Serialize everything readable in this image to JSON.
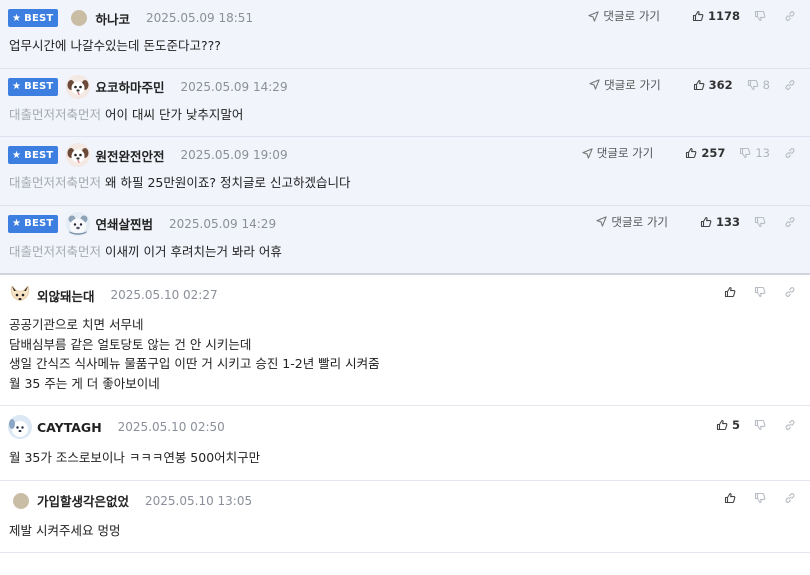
{
  "labels": {
    "best": "BEST",
    "reply": "댓글로 가기"
  },
  "comments": [
    {
      "best": true,
      "nick": "하나코",
      "date": "2025.05.09 18:51",
      "up": "1178",
      "down": "",
      "show_reply": true,
      "quote": "",
      "lines": [
        "업무시간에 나갈수있는데 돈도준다고???"
      ]
    },
    {
      "best": true,
      "nick": "요코하마주민",
      "date": "2025.05.09 14:29",
      "up": "362",
      "down": "8",
      "show_reply": true,
      "quote": "대출먼저저축먼저",
      "lines": [
        "어이 대씨 단가 낮추지말어"
      ]
    },
    {
      "best": true,
      "nick": "원전완전안전",
      "date": "2025.05.09 19:09",
      "up": "257",
      "down": "13",
      "show_reply": true,
      "quote": "대출먼저저축먼저",
      "lines": [
        "왜 하필 25만원이죠? 정치글로 신고하겠습니다"
      ]
    },
    {
      "best": true,
      "nick": "연쇄살찐범",
      "date": "2025.05.09 14:29",
      "up": "133",
      "down": "",
      "show_reply": true,
      "quote": "대출먼저저축먼저",
      "lines": [
        "이새끼 이거 후려치는거 봐라 어휴"
      ]
    },
    {
      "best": false,
      "nick": "외않돼는대",
      "date": "2025.05.10 02:27",
      "up": "",
      "down": "",
      "show_reply": false,
      "quote": "",
      "lines": [
        "공공기관으로 치면 서무네",
        "담배심부름 같은 얼토당토 않는 건 안 시키는데",
        "생일 간식즈 식사메뉴 물품구입 이딴 거 시키고 승진 1-2년 빨리 시켜줌",
        "월 35 주는 게 더 좋아보이네"
      ]
    },
    {
      "best": false,
      "nick": "CAYTAGH",
      "date": "2025.05.10 02:50",
      "up": "5",
      "down": "",
      "show_reply": false,
      "quote": "",
      "lines": [
        "월 35가 조스로보이나 ㅋㅋㅋ연봉 500어치구만"
      ]
    },
    {
      "best": false,
      "nick": "가입할생각은없었",
      "date": "2025.05.10 13:05",
      "up": "",
      "down": "",
      "show_reply": false,
      "quote": "",
      "lines": [
        "제발 시켜주세요 멍멍"
      ]
    }
  ]
}
